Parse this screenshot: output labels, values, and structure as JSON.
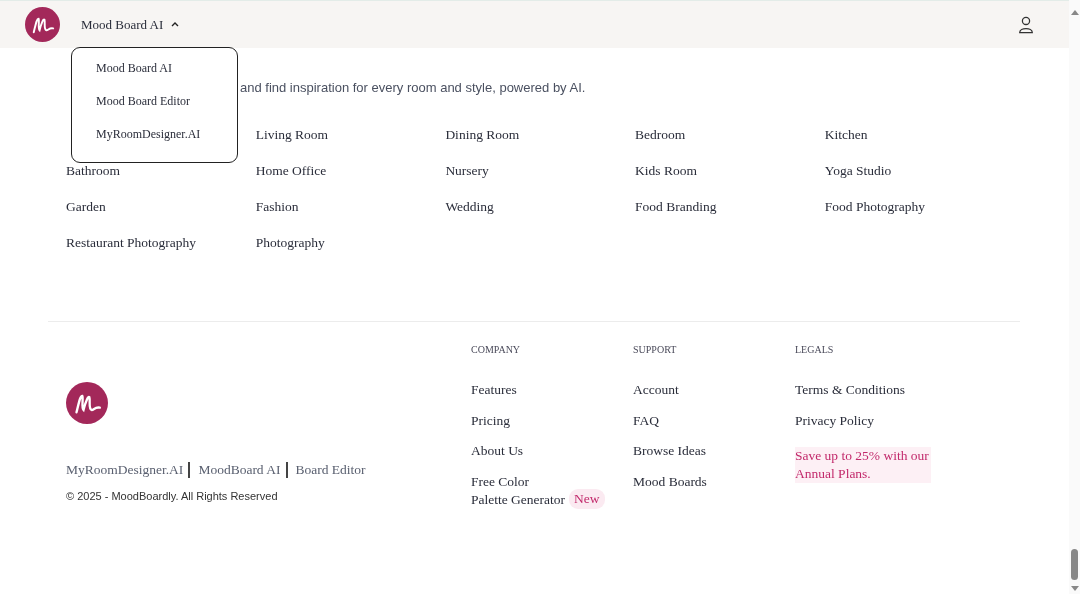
{
  "header": {
    "menu_label": "Mood Board AI",
    "menu_expanded": true,
    "menu_items": [
      "Mood Board AI",
      "Mood Board Editor",
      "MyRoomDesigner.AI"
    ]
  },
  "intro": {
    "subtitle_rest": "and find inspiration for every room and style, powered by AI."
  },
  "categories": [
    "Living Room",
    "Dining Room",
    "Bedroom",
    "Kitchen",
    "Bathroom",
    "Home Office",
    "Nursery",
    "Kids Room",
    "Yoga Studio",
    "Garden",
    "Fashion",
    "Wedding",
    "Food Branding",
    "Food Photography",
    "Restaurant Photography",
    "Photography"
  ],
  "footer": {
    "brand_links": [
      "MyRoomDesigner.AI",
      "MoodBoard AI",
      "Board Editor"
    ],
    "copyright": "© 2025 - MoodBoardly. All Rights Reserved",
    "columns": [
      {
        "title": "COMPANY",
        "links": [
          {
            "label": "Features"
          },
          {
            "label": "Pricing"
          },
          {
            "label": "About Us"
          },
          {
            "label": "Free Color Palette Generator",
            "badge": "New"
          }
        ]
      },
      {
        "title": "SUPPORT",
        "links": [
          {
            "label": "Account"
          },
          {
            "label": "FAQ"
          },
          {
            "label": "Browse Ideas"
          },
          {
            "label": "Mood Boards"
          }
        ]
      },
      {
        "title": "LEGALS",
        "links": [
          {
            "label": "Terms & Conditions"
          },
          {
            "label": "Privacy Policy"
          }
        ],
        "promo": "Save up to 25% with our Annual Plans."
      }
    ]
  }
}
